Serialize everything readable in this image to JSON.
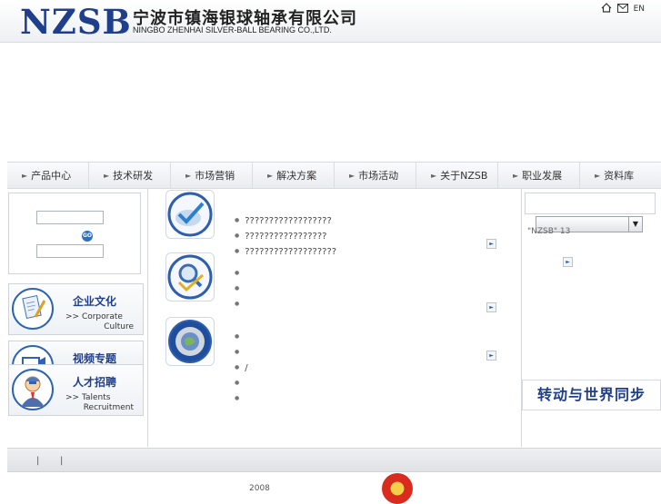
{
  "header": {
    "logo": "NZSB",
    "company_cn": "宁波市镇海银球轴承有限公司",
    "company_en": "NINGBO ZHENHAI SILVER-BALL BEARING CO.,LTD.",
    "icons": [
      "home-icon",
      "mail-icon"
    ],
    "lang_label": "EN"
  },
  "nav": {
    "items": [
      "产品中心",
      "技术研发",
      "市场营销",
      "解决方案",
      "市场活动",
      "关于NZSB",
      "职业发展",
      "资料库"
    ]
  },
  "login": {
    "go_label": "GO"
  },
  "promos": [
    {
      "cn": "企业文化",
      "en1": ">> Corporate",
      "en2": "Culture",
      "icon": "document-pen-icon"
    },
    {
      "cn": "视频专题",
      "en1": "",
      "en2": "",
      "icon": "video-camera-icon"
    },
    {
      "cn": "人才招聘",
      "en1": ">> Talents",
      "en2": "Recruitment",
      "icon": "person-icon"
    }
  ],
  "sections": [
    {
      "icon": "globe-check-icon",
      "bullets": [
        "??????????????????",
        "?????????????????",
        "???????????????????"
      ]
    },
    {
      "icon": "magnifier-check-icon",
      "bullets": [
        "",
        "",
        ""
      ]
    },
    {
      "icon": "bearing-globe-icon",
      "bullets": [
        "",
        "",
        "/",
        "",
        ""
      ]
    }
  ],
  "right": {
    "select_value": "\"NZSB\"  13",
    "slogan": "转动与世界同步"
  },
  "footer": {
    "year": "2008"
  },
  "colors": {
    "brand": "#1f3e8c",
    "accent": "#2c6fc7"
  }
}
